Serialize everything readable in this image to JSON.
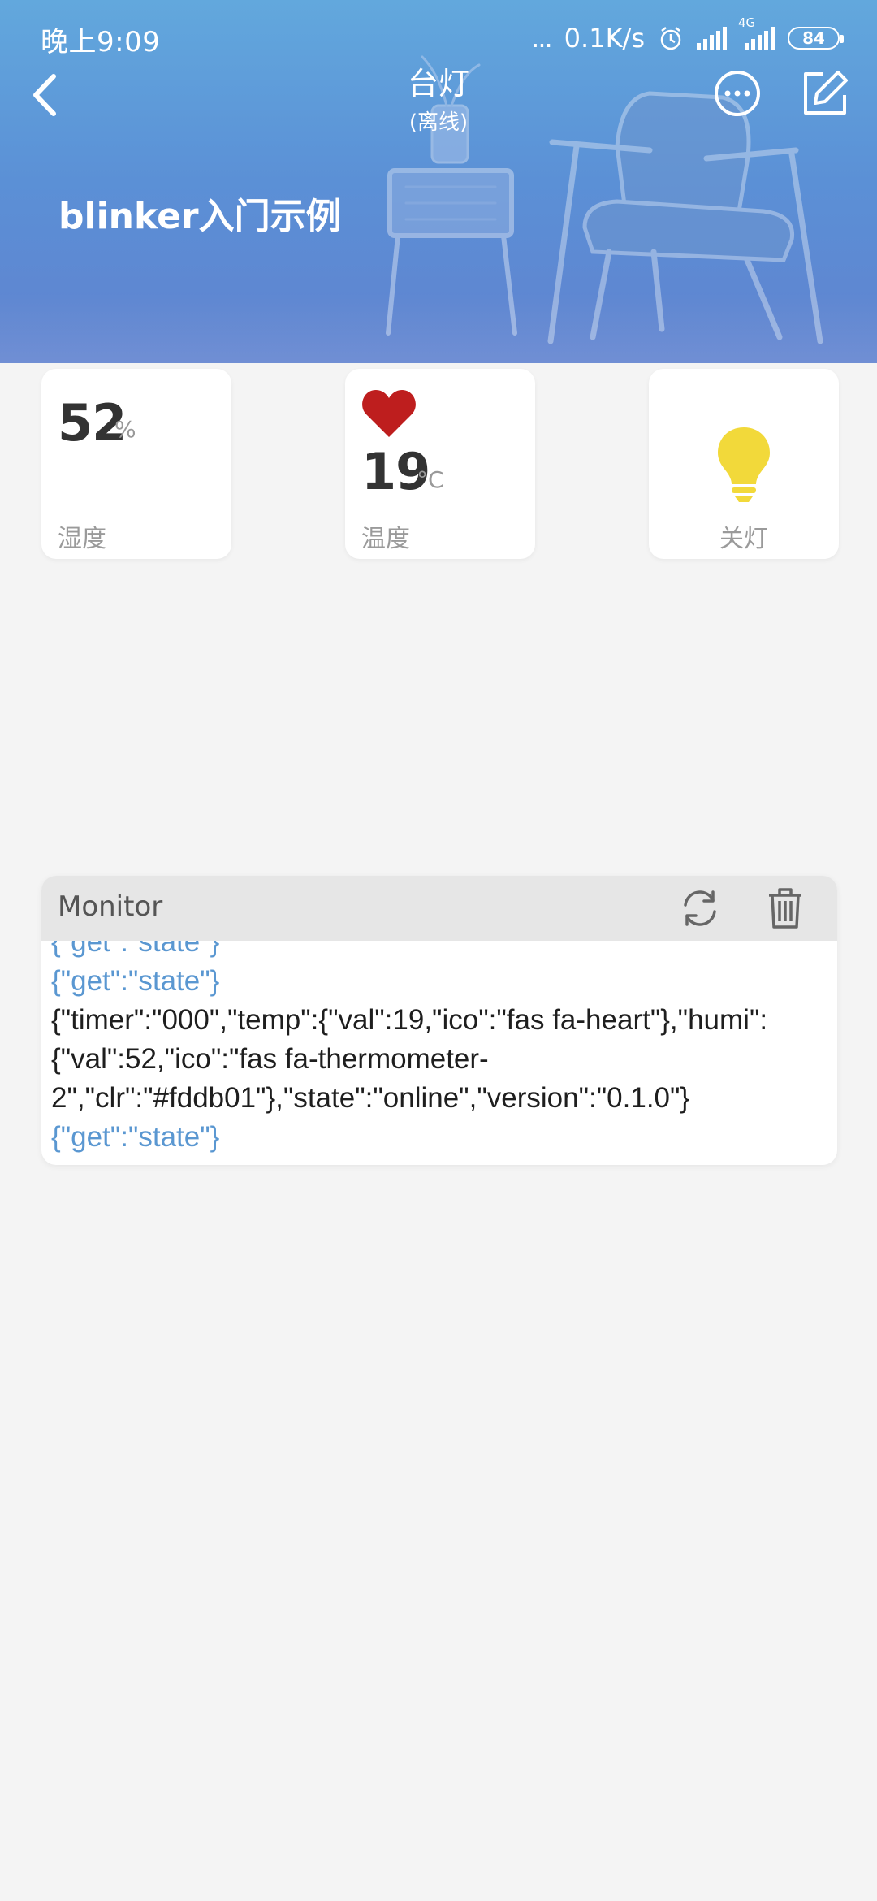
{
  "status_bar": {
    "time": "晚上9:09",
    "network_dots": "...",
    "net_speed": "0.1K/s",
    "network_type": "4G",
    "battery": "84"
  },
  "header": {
    "title": "台灯",
    "subtitle": "(离线)",
    "page_heading": "blinker入门示例",
    "back_icon": "chevron-left-icon",
    "more_icon": "more-circle-icon",
    "edit_icon": "edit-icon"
  },
  "widgets": {
    "humidity": {
      "value": "52",
      "unit": "%",
      "label": "湿度"
    },
    "temperature": {
      "value": "19",
      "unit": "°C",
      "label": "温度",
      "icon": "heart-icon",
      "icon_color": "#be1e1e"
    },
    "lamp": {
      "label": "关灯",
      "icon": "lightbulb-icon",
      "icon_color": "#f2d93a"
    }
  },
  "monitor": {
    "title": "Monitor",
    "refresh_icon": "refresh-icon",
    "delete_icon": "trash-icon",
    "logs": [
      {
        "kind": "sent",
        "lines": [
          "{\"get\":\"state\"}"
        ]
      },
      {
        "kind": "sent",
        "lines": [
          "{\"get\":\"state\"}"
        ]
      },
      {
        "kind": "recv",
        "lines": [
          "{\"timer\":\"000\",\"temp\":{\"val\":19,\"ico\":\"fas fa-heart\"},\"humi\":",
          "{\"val\":52,\"ico\":\"fas fa-thermometer-",
          "2\",\"clr\":\"#fddb01\"},\"state\":\"online\",\"version\":\"0.1.0\"}"
        ]
      },
      {
        "kind": "sent",
        "lines": [
          "{\"get\":\"state\"}"
        ]
      }
    ]
  },
  "colors": {
    "header_gradient_top": "#62a8dd",
    "header_gradient_bottom": "#6082cf",
    "sent_text": "#5a97d1",
    "received_text": "#1e1e1e",
    "background": "#f4f4f4"
  }
}
